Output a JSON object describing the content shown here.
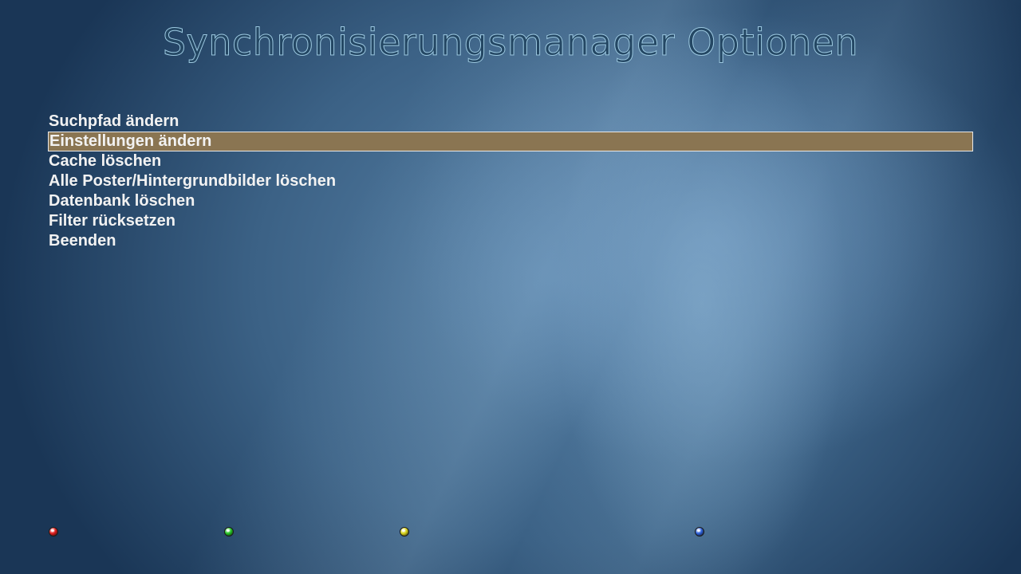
{
  "title": "Synchronisierungsmanager Optionen",
  "menu": {
    "items": [
      {
        "label": "Suchpfad ändern"
      },
      {
        "label": "Einstellungen ändern"
      },
      {
        "label": "Cache löschen"
      },
      {
        "label": "Alle Poster/Hintergrundbilder löschen"
      },
      {
        "label": "Datenbank löschen"
      },
      {
        "label": "Filter rücksetzen"
      },
      {
        "label": "Beenden"
      }
    ],
    "selected_label": "Einstellungen ändern"
  },
  "color_buttons": [
    {
      "color": "red",
      "hex": "#e01b1b"
    },
    {
      "color": "green",
      "hex": "#22c422"
    },
    {
      "color": "yellow",
      "hex": "#d8d41a"
    },
    {
      "color": "blue",
      "hex": "#2b5fd9"
    }
  ],
  "colors": {
    "selection_background": "#8a7552",
    "selection_border": "#e8e8e8",
    "menu_text": "#f2f2f2",
    "title_outline": "#9cc8e0"
  }
}
